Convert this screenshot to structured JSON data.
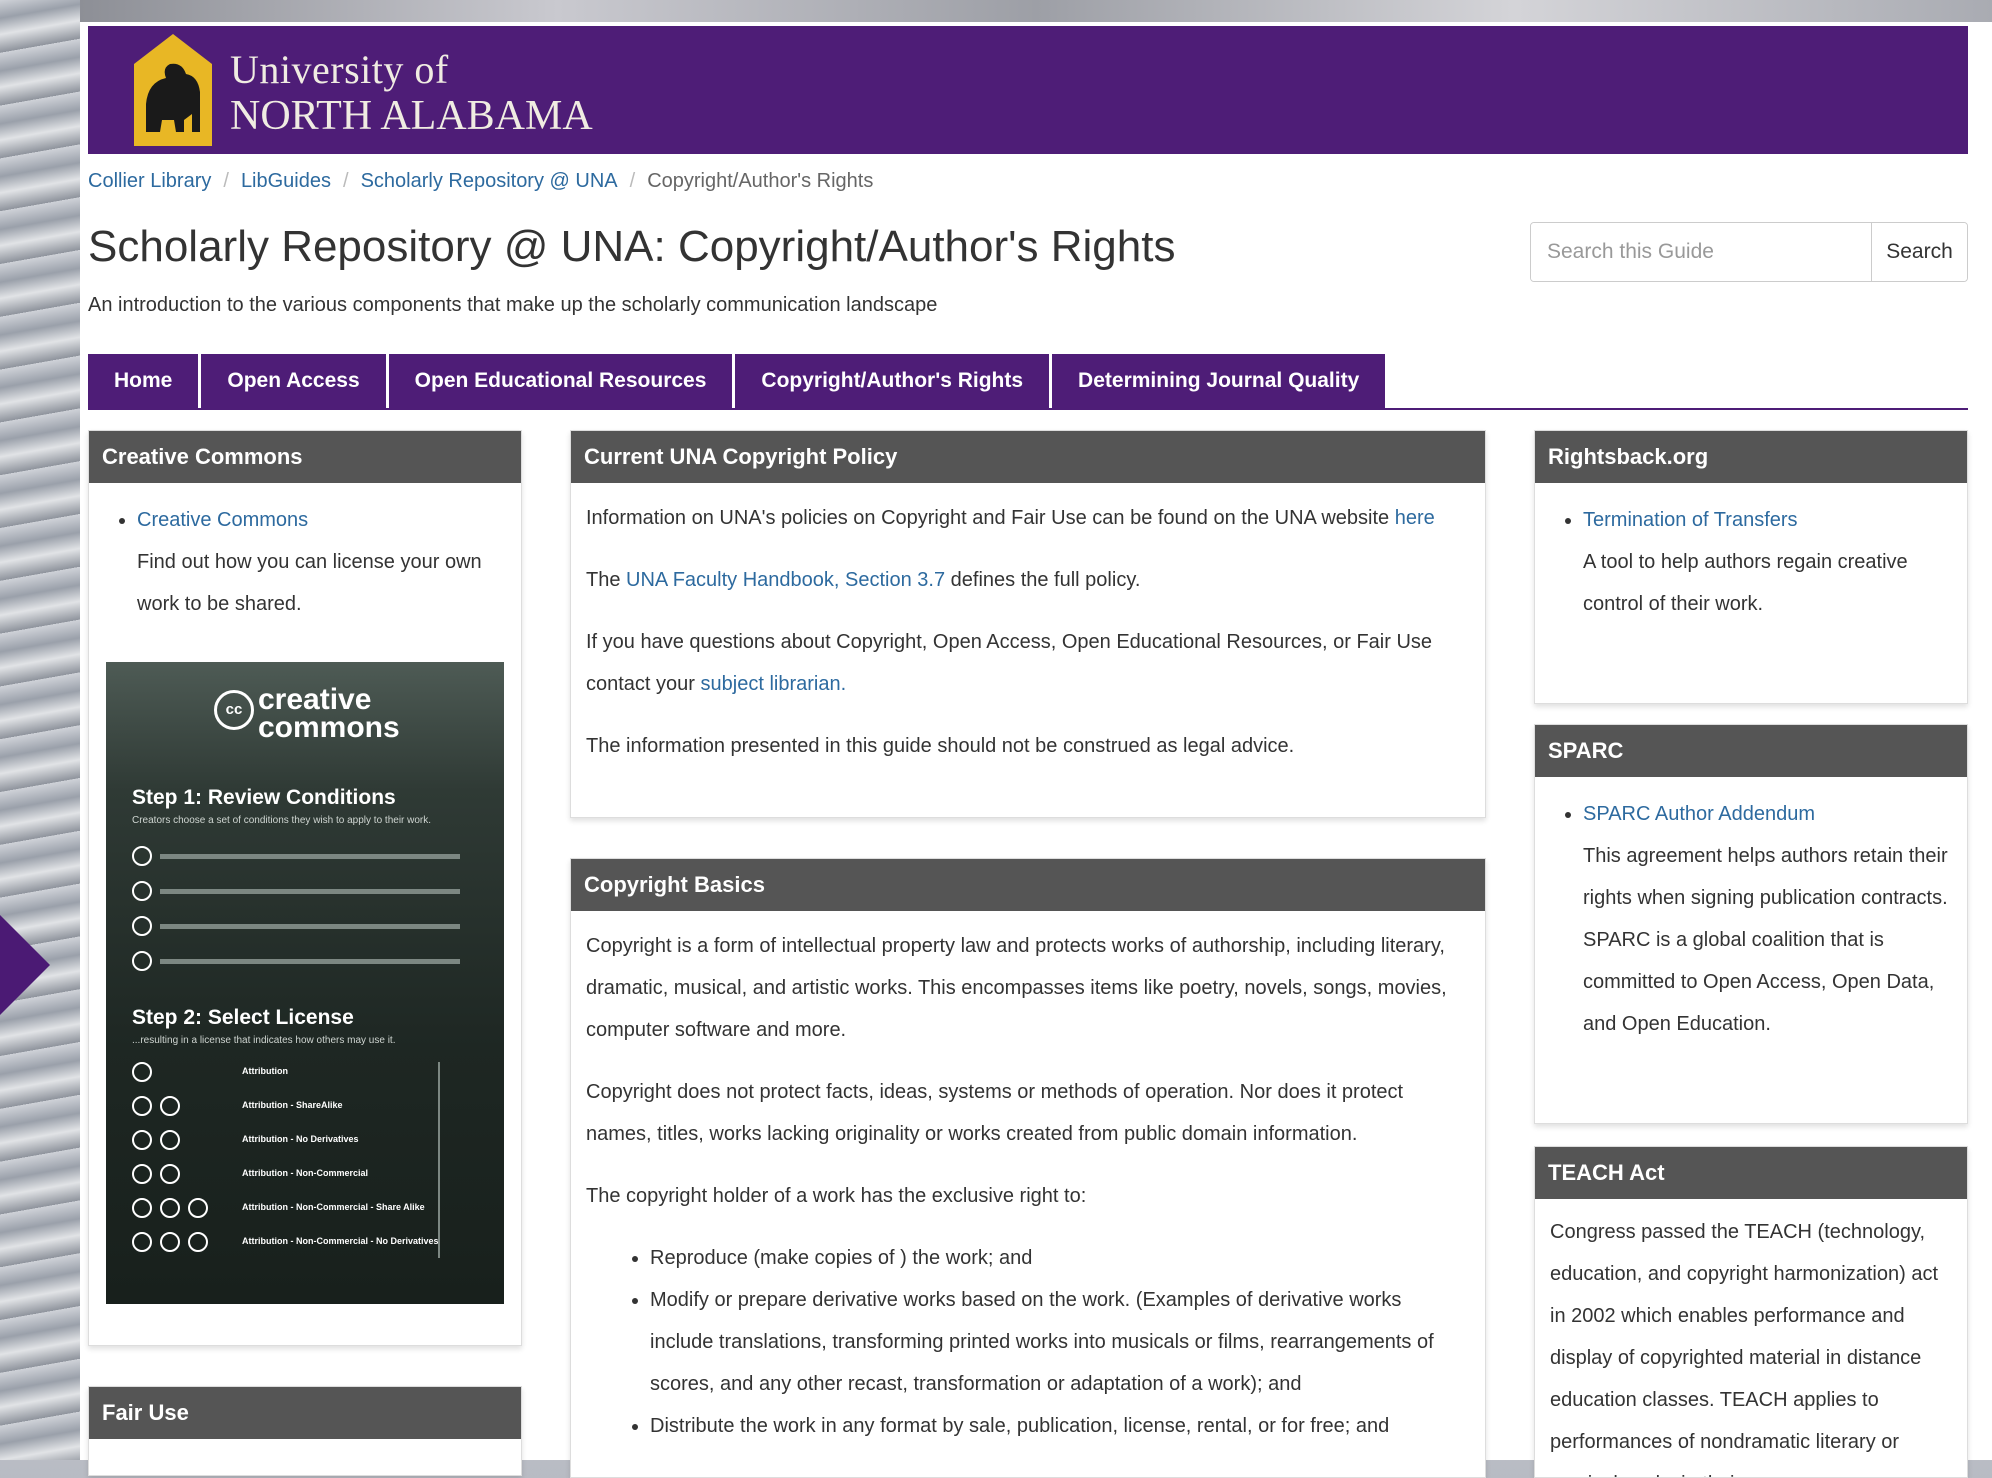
{
  "logo": {
    "line1": "University of",
    "line2": "NORTH ALABAMA"
  },
  "breadcrumb": [
    "Collier Library",
    "LibGuides",
    "Scholarly Repository @ UNA",
    "Copyright/Author's Rights"
  ],
  "title": "Scholarly Repository @ UNA: Copyright/Author's Rights",
  "subtitle": "An introduction to the various components that make up the scholarly communication landscape",
  "search": {
    "placeholder": "Search this Guide",
    "button": "Search"
  },
  "tabs": [
    "Home",
    "Open Access",
    "Open Educational Resources",
    "Copyright/Author's Rights",
    "Determining Journal Quality"
  ],
  "creative_commons": {
    "heading": "Creative Commons",
    "link": "Creative Commons",
    "desc": "Find out how you can license your own work to be shared.",
    "image": {
      "logo": "creative commons",
      "cc_mark": "cc",
      "step1": "Step 1: Review Conditions",
      "step1_sub": "Creators choose a set of conditions they wish to apply to their work.",
      "step2": "Step 2: Select License",
      "step2_sub": "...resulting in a license that indicates how others may use it.",
      "licenses": [
        "Attribution",
        "Attribution - ShareAlike",
        "Attribution - No Derivatives",
        "Attribution - Non-Commercial",
        "Attribution - Non-Commercial - Share Alike",
        "Attribution - Non-Commercial - No Derivatives"
      ]
    }
  },
  "fair_use": {
    "heading": "Fair Use"
  },
  "policy": {
    "heading": "Current UNA Copyright Policy",
    "p1_text": "Information on UNA's policies on Copyright and Fair Use can be found on the UNA website ",
    "p1_link": "here",
    "p2_pre": "The ",
    "p2_link": "UNA Faculty Handbook, Section 3.7",
    "p2_post": " defines the full policy.",
    "p3_text": "If you have questions about Copyright, Open Access, Open Educational Resources, or Fair Use contact your ",
    "p3_link": "subject librarian.",
    "p4": "The information presented in this guide should not be construed as legal advice."
  },
  "basics": {
    "heading": "Copyright Basics",
    "p1": "Copyright is a form of intellectual property law and protects works of authorship, including literary, dramatic, musical, and artistic works. This encompasses items like poetry, novels, songs, movies, computer software and more.",
    "p2": "Copyright does not protect facts, ideas, systems or methods of operation. Nor does it protect names, titles, works lacking originality or works created from public domain information.",
    "p3": "The copyright holder of a work has the exclusive right to:",
    "rights": [
      "Reproduce (make copies of ) the work; and",
      "Modify or prepare derivative works based on the work. (Examples of derivative works include translations, transforming printed works into musicals or films, rearrangements of scores, and any other recast, transformation or adaptation of a work); and",
      "Distribute the work in any format by sale, publication, license, rental, or for free; and"
    ]
  },
  "rightsback": {
    "heading": "Rightsback.org",
    "link": "Termination of Transfers",
    "desc": "A tool to help authors regain creative control of their work."
  },
  "sparc": {
    "heading": "SPARC",
    "link": "SPARC Author Addendum",
    "desc": "This agreement helps authors retain their rights when signing publication contracts. SPARC is a global coalition that is committed to Open Access, Open Data, and Open Education."
  },
  "teach": {
    "heading": "TEACH Act",
    "text": "Congress passed the TEACH (technology, education, and copyright harmonization) act in 2002 which enables performance and display of copyrighted material in distance education classes.  TEACH applies to performances of nondramatic literary or musical works in their"
  },
  "colors": {
    "brand_purple": "#4e1d77",
    "link_blue": "#2d6a9f",
    "box_header": "#555555",
    "logo_gold": "#e8b725"
  }
}
